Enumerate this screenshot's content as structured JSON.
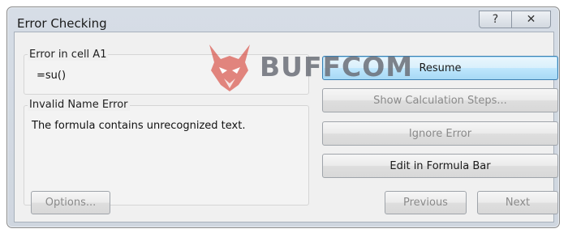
{
  "window": {
    "title": "Error Checking",
    "help_label": "?",
    "close_label": "✕"
  },
  "error_group": {
    "label": "Error in cell A1",
    "formula": "=su()"
  },
  "description_group": {
    "label": "Invalid Name Error",
    "message": "The formula contains unrecognized text."
  },
  "actions": {
    "resume": "Resume",
    "show_steps": "Show Calculation Steps...",
    "ignore": "Ignore Error",
    "edit": "Edit in Formula Bar"
  },
  "footer": {
    "options": "Options...",
    "previous": "Previous",
    "next": "Next"
  },
  "watermark": {
    "text": "BUFFCOM",
    "logo_icon": "bull-head-icon"
  },
  "colors": {
    "window_frame": "#cfd6df",
    "client_bg": "#f0f0f0",
    "default_button": "#bee6fd",
    "watermark_red": "#d63a2f"
  }
}
